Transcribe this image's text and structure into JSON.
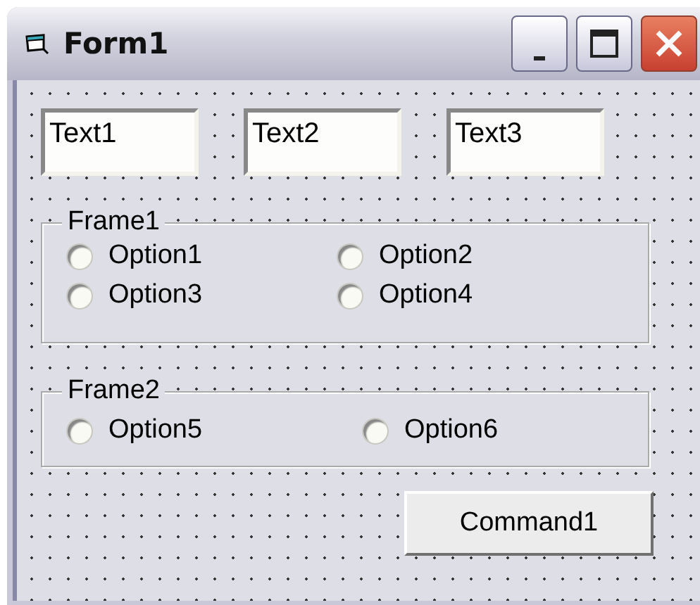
{
  "window": {
    "title": "Form1"
  },
  "textboxes": [
    {
      "value": "Text1"
    },
    {
      "value": "Text2"
    },
    {
      "value": "Text3"
    }
  ],
  "frames": [
    {
      "caption": "Frame1",
      "options": [
        {
          "label": "Option1",
          "selected": false
        },
        {
          "label": "Option2",
          "selected": false
        },
        {
          "label": "Option3",
          "selected": false
        },
        {
          "label": "Option4",
          "selected": false
        }
      ]
    },
    {
      "caption": "Frame2",
      "options": [
        {
          "label": "Option5",
          "selected": false
        },
        {
          "label": "Option6",
          "selected": false
        }
      ]
    }
  ],
  "command_button": {
    "label": "Command1"
  }
}
